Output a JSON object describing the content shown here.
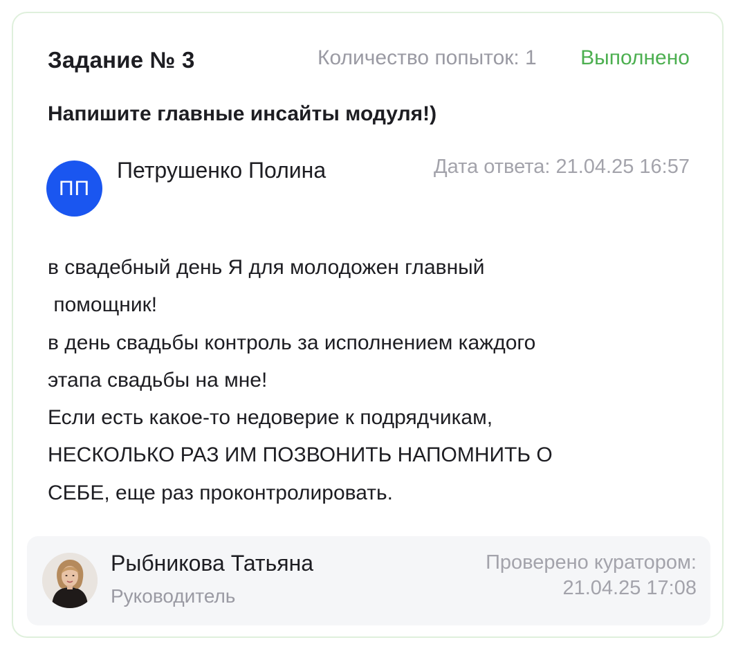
{
  "task": {
    "title": "Задание № 3",
    "attempts": "Количество попыток: 1",
    "status": "Выполнено",
    "question": "Напишите главные инсайты модуля!)"
  },
  "answer": {
    "avatar_initials": "ПП",
    "author_name": "Петрушенко Полина",
    "date": "Дата ответа: 21.04.25 16:57",
    "lines": [
      "в свадебный день Я для молодожен главный",
      " помощник!",
      "в день свадьбы контроль за исполнением каждого",
      "этапа свадьбы на мне!",
      "Если есть какое-то недоверие к подрядчикам,",
      "НЕСКОЛЬКО РАЗ ИМ ПОЗВОНИТЬ НАПОМНИТЬ О",
      "СЕБЕ, еще раз проконтролировать."
    ]
  },
  "curator": {
    "name": "Рыбникова Татьяна",
    "role": "Руководитель",
    "checked_label": "Проверено куратором:",
    "checked_date": "21.04.25 17:08"
  },
  "colors": {
    "accent_green": "#4caf50",
    "avatar_blue": "#1a56f0",
    "card_border": "#dff0dc",
    "muted_text": "#9a9aa3"
  }
}
